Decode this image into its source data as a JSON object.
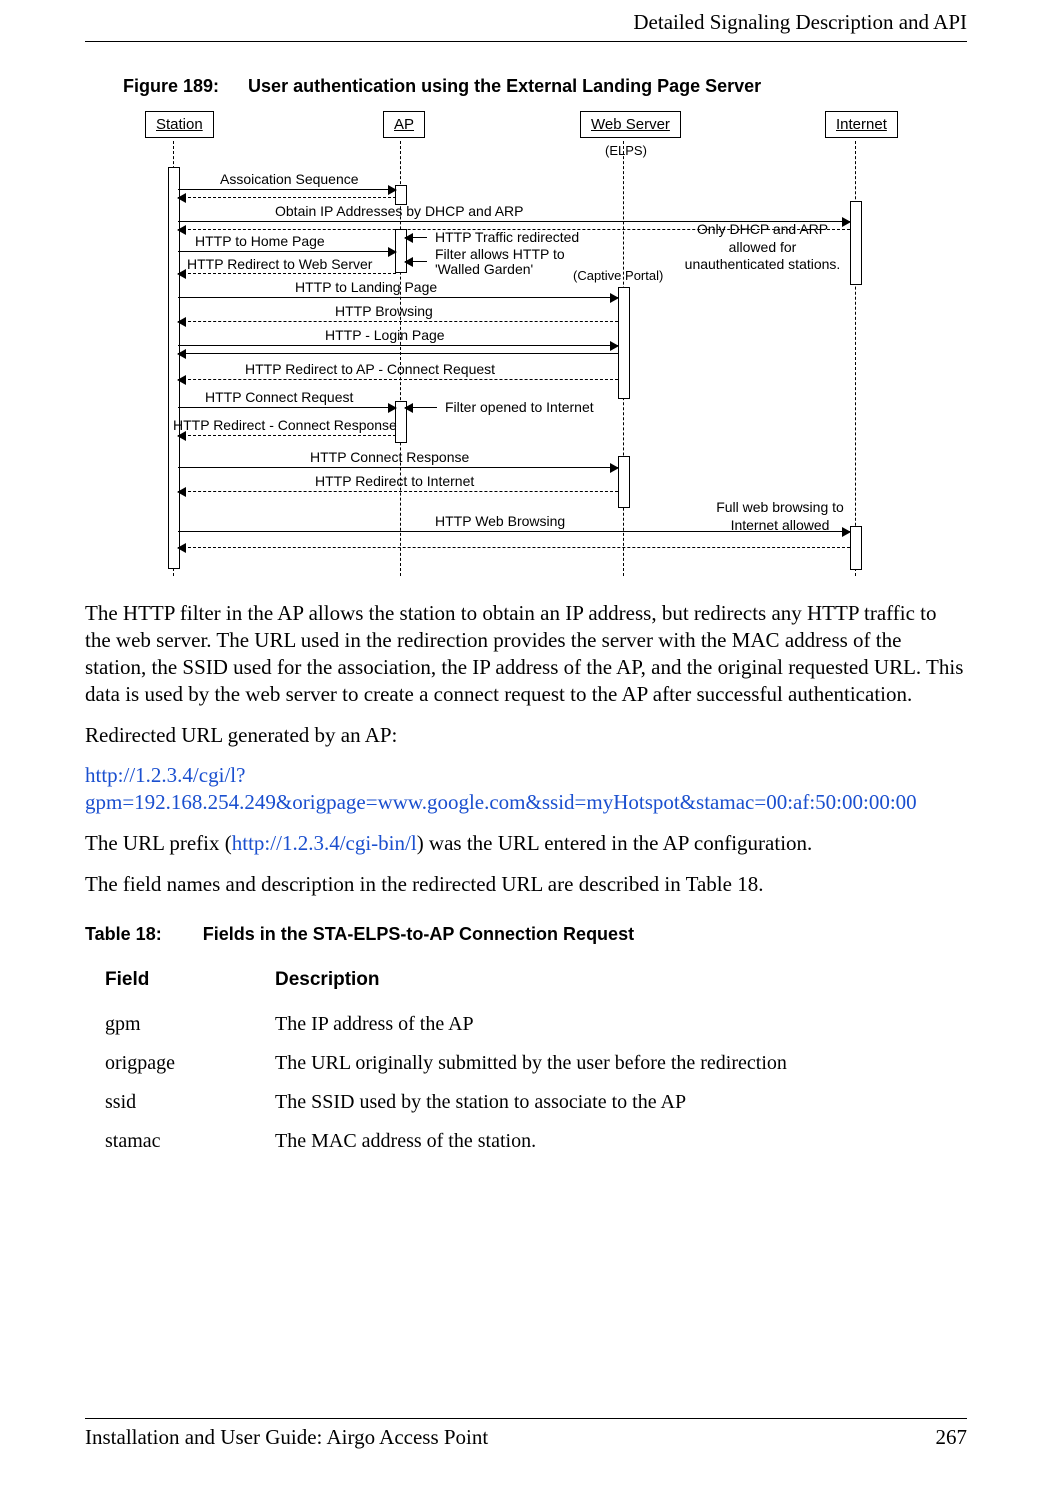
{
  "header": {
    "section_title": "Detailed Signaling Description and API"
  },
  "figure": {
    "label": "Figure 189:",
    "caption": "User authentication using the External Landing Page Server",
    "actors": {
      "station": "Station",
      "ap": "AP",
      "web": "Web Server",
      "internet": "Internet"
    },
    "overlays": {
      "elps": "(ELPS)",
      "captive": "(Captive Portal)"
    },
    "messages": {
      "assoc": "Assoication Sequence",
      "dhcp": "Obtain IP Addresses by DHCP and ARP",
      "http_home": "HTTP to Home Page",
      "http_redirected": "HTTP Traffic  redirected",
      "filter_walled": "Filter allows HTTP to 'Walled Garden'",
      "http_redir_web": "HTTP Redirect to Web Server",
      "http_landing": "HTTP to Landing Page",
      "http_browsing": "HTTP Browsing",
      "http_login": "HTTP - Login Page",
      "http_redir_ap": "HTTP Redirect to AP - Connect Request",
      "http_conn_req": "HTTP Connect Request",
      "filter_open": "Filter opened to Internet",
      "http_redir_resp": "HTTP Redirect - Connect Response",
      "http_conn_resp": "HTTP Connect Response",
      "http_redir_int": "HTTP Redirect to Internet",
      "http_web_browse": "HTTP Web Browsing"
    },
    "notes": {
      "only_dhcp": "Only DHCP and ARP allowed for unauthenticated stations.",
      "full_browse": "Full web browsing to Internet allowed"
    }
  },
  "paragraphs": {
    "p1": "The HTTP filter in the AP allows the station to obtain an IP address, but redirects any HTTP traffic to the web server. The URL used in the redirection provides the server with the MAC address of the station, the SSID used for the association, the IP address of the AP, and the original requested URL. This data is used by the web server to create a connect request to the AP after successful authentication.",
    "p2": "Redirected URL generated by an AP:",
    "url": "http://1.2.3.4/cgi/l?gpm=192.168.254.249&origpage=www.google.com&ssid=myHotspot&stamac=00:af:50:00:00:00",
    "p3_pre": "The URL prefix (",
    "p3_link": "http://1.2.3.4/cgi-bin/l",
    "p3_post": ") was the URL entered in the AP configuration.",
    "p4": "The field names and description in the redirected URL are described in Table 18."
  },
  "table": {
    "label": "Table 18:",
    "caption": "Fields in the STA-ELPS-to-AP Connection Request",
    "headers": {
      "field": "Field",
      "desc": "Description"
    },
    "rows": [
      {
        "field": "gpm",
        "desc": "The IP address of the AP"
      },
      {
        "field": "origpage",
        "desc": "The URL originally submitted by the user before the redirection"
      },
      {
        "field": "ssid",
        "desc": "The SSID used by the station to associate to the AP"
      },
      {
        "field": "stamac",
        "desc": "The MAC address of the station."
      }
    ]
  },
  "footer": {
    "doc_title": "Installation and User Guide: Airgo Access Point",
    "page_num": "267"
  }
}
